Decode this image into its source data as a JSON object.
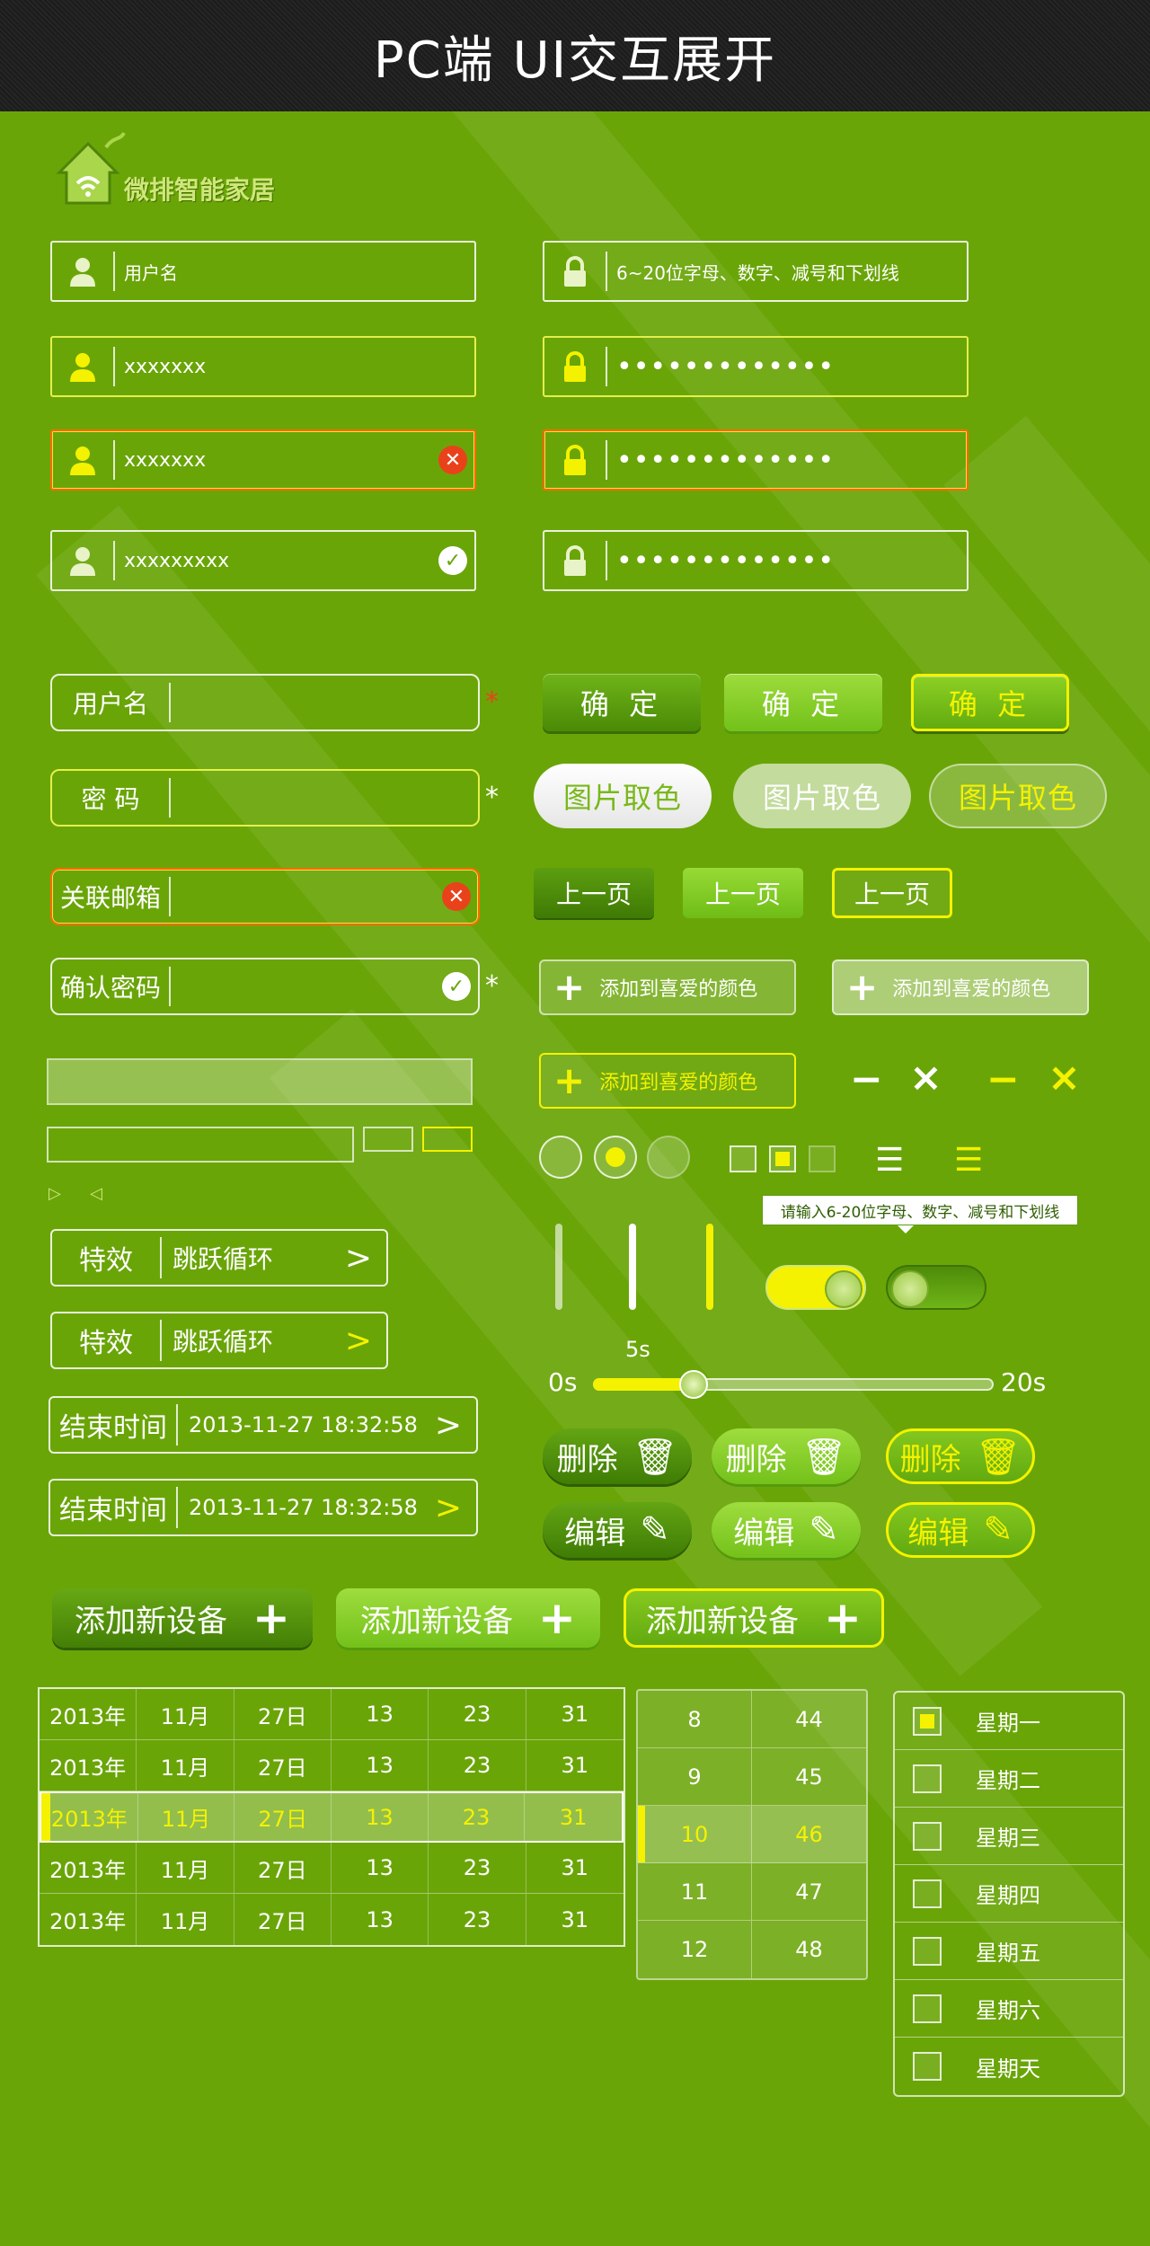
{
  "header": {
    "title": "PC端   UI交互展开"
  },
  "logo": {
    "text": "微排智能家居"
  },
  "login_fields": [
    {
      "value": "用户名",
      "icon": "user-icon"
    },
    {
      "value": "xxxxxxx",
      "icon": "user-icon"
    },
    {
      "value": "xxxxxxx",
      "icon": "user-icon"
    },
    {
      "value": "xxxxxxxxx",
      "icon": "user-icon"
    }
  ],
  "password_fields": [
    {
      "value": "6~20位字母、数字、减号和下划线",
      "icon": "lock-icon"
    },
    {
      "value": "•••••••••••••",
      "icon": "lock-icon"
    },
    {
      "value": "•••••••••••••",
      "icon": "lock-icon"
    },
    {
      "value": "•••••••••••••",
      "icon": "lock-icon"
    }
  ],
  "form": {
    "username": "用户名",
    "password": "密 码",
    "email": "关联邮箱",
    "confirm": "确认密码",
    "required_mark": "*"
  },
  "buttons": {
    "confirm": "确 定",
    "pick_color": "图片取色",
    "prev_page": "上一页",
    "add_favorite": "添加到喜爱的颜色",
    "minus": "−",
    "close": "×"
  },
  "arrows": {
    "right_small": "▷",
    "left_small": "◁"
  },
  "selects": [
    {
      "key": "特效",
      "value": "跳跃循环",
      "arrow": ">"
    },
    {
      "key": "特效",
      "value": "跳跃循环",
      "arrow": ">"
    },
    {
      "key": "结束时间",
      "value": "2013-11-27   18:32:58",
      "arrow": ">"
    },
    {
      "key": "结束时间",
      "value": "2013-11-27   18:32:58",
      "arrow": ">"
    }
  ],
  "tooltip": "请输入6-20位字母、数字、减号和下划线",
  "slider": {
    "min_label": "0s",
    "max_label": "20s",
    "current_label": "5s",
    "value": 5,
    "max": 20
  },
  "actions": {
    "delete": "删除",
    "edit": "编辑",
    "add_device": "添加新设备"
  },
  "date_rows": [
    [
      "2013年",
      "11月",
      "27日",
      "13",
      "23",
      "31"
    ],
    [
      "2013年",
      "11月",
      "27日",
      "13",
      "23",
      "31"
    ],
    [
      "2013年",
      "11月",
      "27日",
      "13",
      "23",
      "31"
    ],
    [
      "2013年",
      "11月",
      "27日",
      "13",
      "23",
      "31"
    ],
    [
      "2013年",
      "11月",
      "27日",
      "13",
      "23",
      "31"
    ]
  ],
  "time_rows": [
    [
      "8",
      "44"
    ],
    [
      "9",
      "45"
    ],
    [
      "10",
      "46"
    ],
    [
      "11",
      "47"
    ],
    [
      "12",
      "48"
    ]
  ],
  "weekdays": [
    "星期一",
    "星期二",
    "星期三",
    "星期四",
    "星期五",
    "星期六",
    "星期天"
  ],
  "colors": {
    "bg": "#6aa508",
    "accent": "#f4f200",
    "error": "#e9421b"
  }
}
